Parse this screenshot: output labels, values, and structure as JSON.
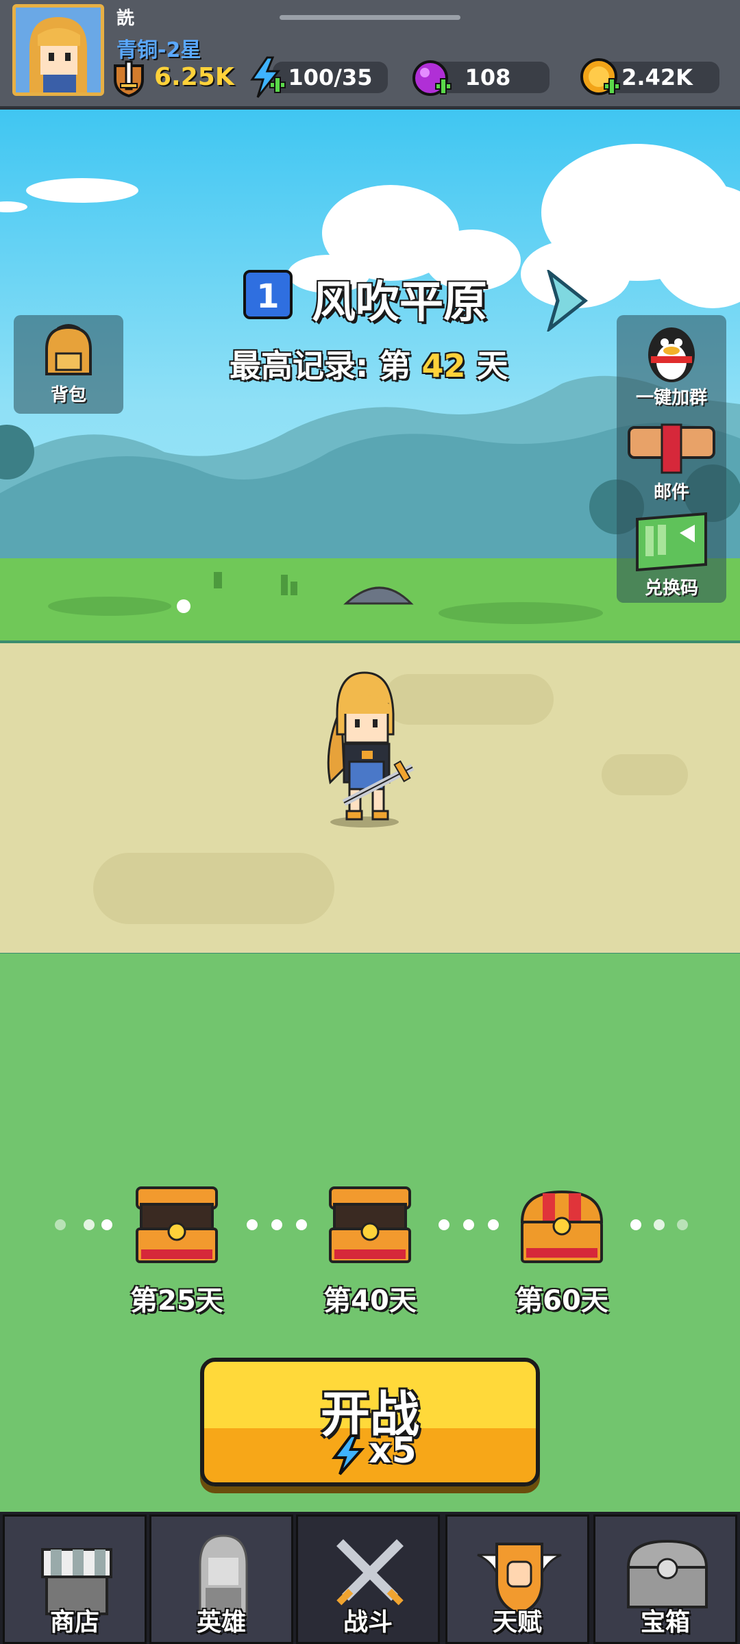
{
  "player": {
    "name": "詵",
    "rank": "青铜-2星",
    "power": "6.25K"
  },
  "resources": {
    "energy": "100/35",
    "gems": "108",
    "gold": "2.42K"
  },
  "level": {
    "number": "1",
    "name": "风吹平原",
    "record_prefix": "最高记录: 第",
    "record_days": "42",
    "record_suffix": "天"
  },
  "side_left": {
    "backpack": "背包"
  },
  "side_right": {
    "group": "一键加群",
    "mail": "邮件",
    "redeem": "兑换码"
  },
  "chests": [
    {
      "label": "第25天"
    },
    {
      "label": "第40天"
    },
    {
      "label": "第60天"
    }
  ],
  "start": {
    "label": "开战",
    "cost": "x5"
  },
  "nav": [
    {
      "label": "商店"
    },
    {
      "label": "英雄"
    },
    {
      "label": "战斗"
    },
    {
      "label": "天赋"
    },
    {
      "label": "宝箱"
    }
  ],
  "colors": {
    "sky": "#40c6f2",
    "grass": "#72c56e",
    "road": "#e0dba6",
    "button": "#ffd93a",
    "topbar": "#555a63",
    "highlight": "#ffd23a"
  }
}
